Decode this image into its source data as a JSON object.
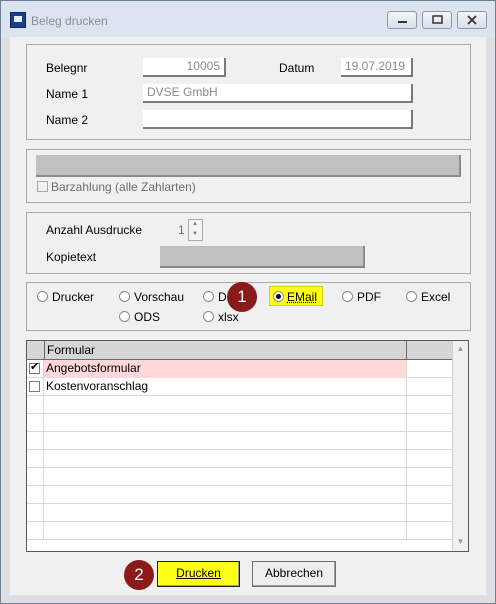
{
  "window": {
    "title": "Beleg drucken"
  },
  "form": {
    "belegnr_label": "Belegnr",
    "belegnr_value": "10005",
    "datum_label": "Datum",
    "datum_value": "19.07.2019",
    "name1_label": "Name 1",
    "name1_value": "DVSE GmbH",
    "name2_label": "Name 2",
    "name2_value": ""
  },
  "payment": {
    "checkbox_label": "Barzahlung (alle Zahlarten)",
    "checked": false
  },
  "print_options": {
    "anzahl_label": "Anzahl Ausdrucke",
    "anzahl_value": "1",
    "kopietext_label": "Kopietext"
  },
  "output": {
    "selected": "EMail",
    "options": [
      "Drucker",
      "Vorschau",
      "D",
      "EMail",
      "PDF",
      "Excel",
      "ODS",
      "xlsx"
    ]
  },
  "annotations": {
    "badge1": "1",
    "badge2": "2"
  },
  "grid": {
    "header": "Formular",
    "rows": [
      {
        "label": "Angebotsformular",
        "checked": true
      },
      {
        "label": "Kostenvoranschlag",
        "checked": false
      }
    ]
  },
  "buttons": {
    "print_label": "Drucken",
    "cancel_label": "Abbrechen"
  },
  "colors": {
    "highlight": "#ffff1a",
    "badge": "#8b1a1a",
    "selected_row": "#ffd9d9"
  }
}
